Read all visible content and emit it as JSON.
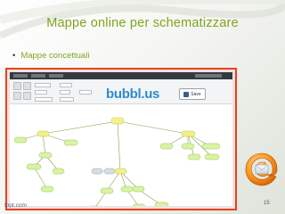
{
  "slide": {
    "title": "Mappe online per schematizzare",
    "bullet": "Mappe concettuali",
    "page_number": "15",
    "footer": "fppt.com",
    "accent_color": "#7fa41f",
    "frame_color": "#e8411d"
  },
  "app": {
    "logo_part1": "bubbl",
    "logo_part2": ".us",
    "save_label": "Save",
    "icons": [
      "undo-icon",
      "redo-icon",
      "zoom-icon",
      "save-icon",
      "floppy-icon"
    ]
  },
  "decor": {
    "icon": "at-sign-icon"
  }
}
